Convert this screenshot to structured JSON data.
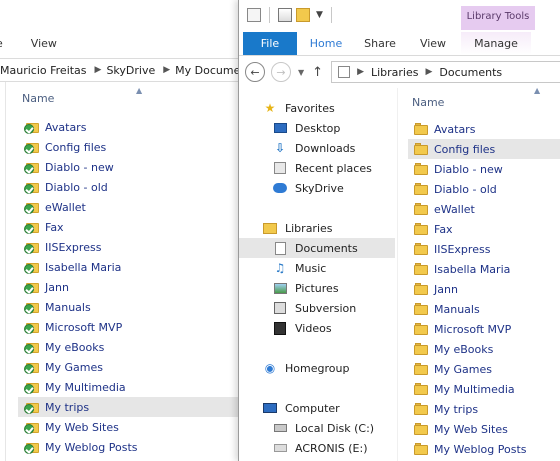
{
  "back_window": {
    "ribbon_tabs": [
      "e",
      "View"
    ],
    "address": [
      "Mauricio Freitas",
      "SkyDrive",
      "My Documents"
    ],
    "column_header": "Name",
    "items": [
      "Avatars",
      "Config files",
      "Diablo - new",
      "Diablo - old",
      "eWallet",
      "Fax",
      "IISExpress",
      "Isabella Maria",
      "Jann",
      "Manuals",
      "Microsoft MVP",
      "My eBooks",
      "My Games",
      "My Multimedia",
      "My trips",
      "My Web Sites",
      "My Weblog Posts"
    ],
    "selected_item": "My trips"
  },
  "front_window": {
    "contextual_tab_group": "Library Tools",
    "tabs": {
      "file": "File",
      "home": "Home",
      "share": "Share",
      "view": "View",
      "manage": "Manage"
    },
    "address": [
      "Libraries",
      "Documents"
    ],
    "nav": {
      "favorites": "Favorites",
      "desktop": "Desktop",
      "downloads": "Downloads",
      "recent_places": "Recent places",
      "skydrive": "SkyDrive",
      "libraries": "Libraries",
      "documents": "Documents",
      "music": "Music",
      "pictures": "Pictures",
      "subversion": "Subversion",
      "videos": "Videos",
      "homegroup": "Homegroup",
      "computer": "Computer",
      "local_disk": "Local Disk (C:)",
      "acronis": "ACRONIS (E:)"
    },
    "column_header": "Name",
    "items": [
      "Avatars",
      "Config files",
      "Diablo - new",
      "Diablo - old",
      "eWallet",
      "Fax",
      "IISExpress",
      "Isabella Maria",
      "Jann",
      "Manuals",
      "Microsoft MVP",
      "My eBooks",
      "My Games",
      "My Multimedia",
      "My trips",
      "My Web Sites",
      "My Weblog Posts"
    ],
    "selected_item": "Config files"
  },
  "colors": {
    "file_tab": "#1979ca",
    "library_tools": "#e6cbf0",
    "item_text": "#1e3287",
    "selection": "#e6e6e6"
  }
}
